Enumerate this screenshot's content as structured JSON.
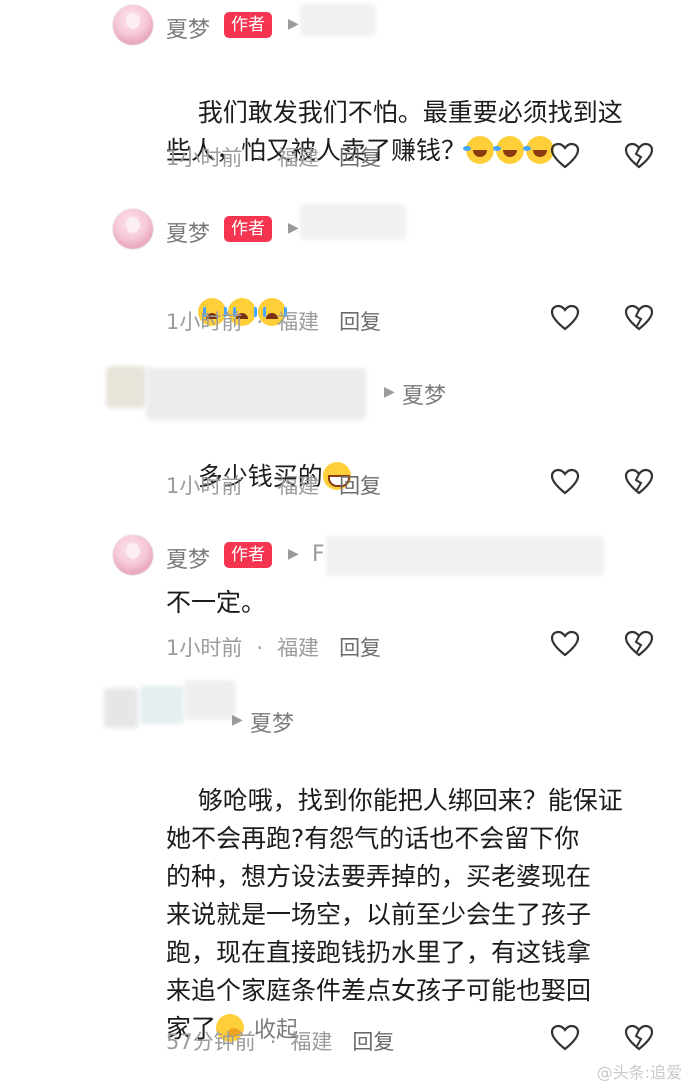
{
  "comments": [
    {
      "username": "夏梦",
      "author_tag": "作者",
      "text": "我们敢发我们不怕。最重要必须找到这\n些人，怕又被人卖了赚钱？",
      "emojis": [
        "laughing-crying-emoji",
        "laughing-crying-emoji",
        "laughing-crying-emoji"
      ],
      "time": "1小时前",
      "location": "福建",
      "reply_label": "回复"
    },
    {
      "username": "夏梦",
      "author_tag": "作者",
      "text": "",
      "emojis": [
        "crying-emoji",
        "crying-emoji",
        "crying-emoji"
      ],
      "time": "1小时前",
      "location": "福建",
      "reply_label": "回复"
    },
    {
      "reply_to": "夏梦",
      "text": "多少钱买的",
      "emojis": [
        "grinning-emoji"
      ],
      "time": "1小时前",
      "location": "福建",
      "reply_label": "回复"
    },
    {
      "username": "夏梦",
      "author_tag": "作者",
      "reply_to_partial": "F",
      "text": "不一定。",
      "time": "1小时前",
      "location": "福建",
      "reply_label": "回复"
    },
    {
      "reply_to": "夏梦",
      "text": "够呛哦，找到你能把人绑回来？能保证\n她不会再跑?有怨气的话也不会留下你\n的种，想方设法要弄掉的，买老婆现在\n来说就是一场空，以前至少会生了孩子\n跑，现在直接跑钱扔水里了，有这钱拿\n来追个家庭条件差点女孩子可能也娶回\n家了",
      "emojis": [
        "shy-emoji"
      ],
      "collapse_label": "收起",
      "time": "57分钟前",
      "location": "福建",
      "reply_label": "回复"
    }
  ],
  "separator": "·",
  "watermark": "@头条:追爱",
  "colors": {
    "author_tag": "#f5344f",
    "meta": "#9c9c9c"
  }
}
